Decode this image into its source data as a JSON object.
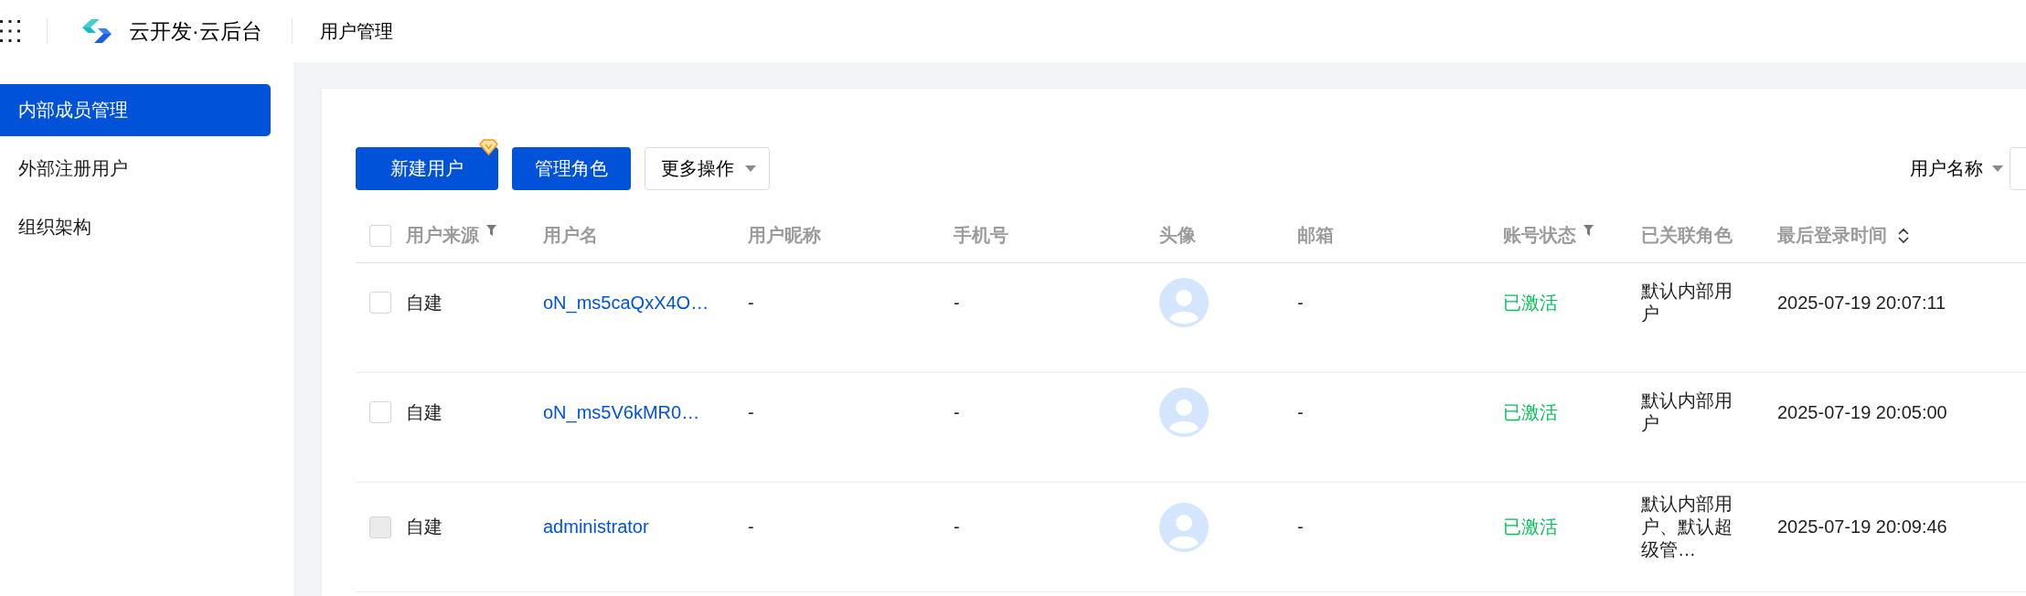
{
  "header": {
    "title": "云开发·云后台",
    "page_title": "用户管理"
  },
  "sidebar": {
    "items": [
      {
        "label": "内部成员管理",
        "selected": true
      },
      {
        "label": "外部注册用户",
        "selected": false
      },
      {
        "label": "组织架构",
        "selected": false
      }
    ]
  },
  "toolbar": {
    "buttons": [
      {
        "label": "新建用户",
        "kind": "primary",
        "premium": true
      },
      {
        "label": "管理角色",
        "kind": "primary",
        "premium": false
      },
      {
        "label": "更多操作",
        "kind": "dropdown",
        "premium": false
      }
    ],
    "search": {
      "field": "用户名称"
    }
  },
  "table": {
    "select_all": {
      "checked": false
    },
    "columns": [
      {
        "label": "用户来源",
        "filter": true,
        "sortable": false
      },
      {
        "label": "用户名",
        "filter": false,
        "sortable": false
      },
      {
        "label": "用户昵称",
        "filter": false,
        "sortable": false
      },
      {
        "label": "手机号",
        "filter": false,
        "sortable": false
      },
      {
        "label": "头像",
        "filter": false,
        "sortable": false
      },
      {
        "label": "邮箱",
        "filter": false,
        "sortable": false
      },
      {
        "label": "账号状态",
        "filter": true,
        "sortable": false
      },
      {
        "label": "已关联角色",
        "filter": false,
        "sortable": false
      },
      {
        "label": "最后登录时间",
        "filter": false,
        "sortable": true
      }
    ],
    "rows": [
      {
        "checked": false,
        "disabled": false,
        "source": "自建",
        "username": "oN_ms5caQxX4O…",
        "nickname": "-",
        "phone": "-",
        "email": "-",
        "status": "已激活",
        "roles": "默认内部用户",
        "last_login": "2025-07-19 20:07:11"
      },
      {
        "checked": false,
        "disabled": false,
        "source": "自建",
        "username": "oN_ms5V6kMR0…",
        "nickname": "-",
        "phone": "-",
        "email": "-",
        "status": "已激活",
        "roles": "默认内部用户",
        "last_login": "2025-07-19 20:05:00"
      },
      {
        "checked": false,
        "disabled": true,
        "source": "自建",
        "username": "administrator",
        "nickname": "-",
        "phone": "-",
        "email": "-",
        "status": "已激活",
        "roles": "默认内部用户、默认超级管…",
        "last_login": "2025-07-19 20:09:46"
      }
    ]
  }
}
